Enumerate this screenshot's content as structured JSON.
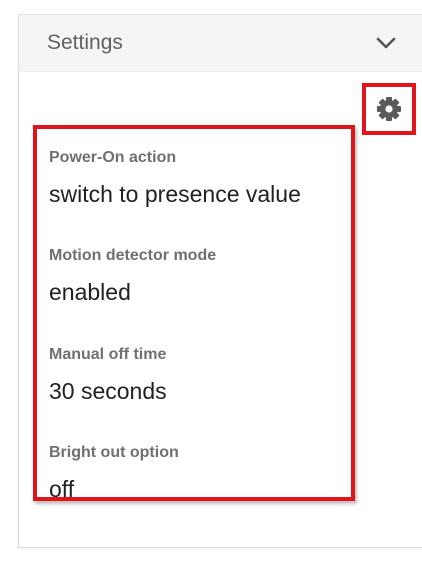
{
  "header": {
    "title": "Settings",
    "collapse_icon": "chevron-down-icon"
  },
  "toolbar": {
    "settings_icon": "gear-icon"
  },
  "settings": [
    {
      "label": "Power-On action",
      "value": "switch to presence value"
    },
    {
      "label": "Motion detector mode",
      "value": "enabled"
    },
    {
      "label": "Manual off time",
      "value": "30 seconds"
    },
    {
      "label": "Bright out option",
      "value": "off"
    }
  ],
  "colors": {
    "highlight": "#e0141a",
    "header_background": "#f5f5f5",
    "label_text": "#707070",
    "value_text": "#212121"
  }
}
